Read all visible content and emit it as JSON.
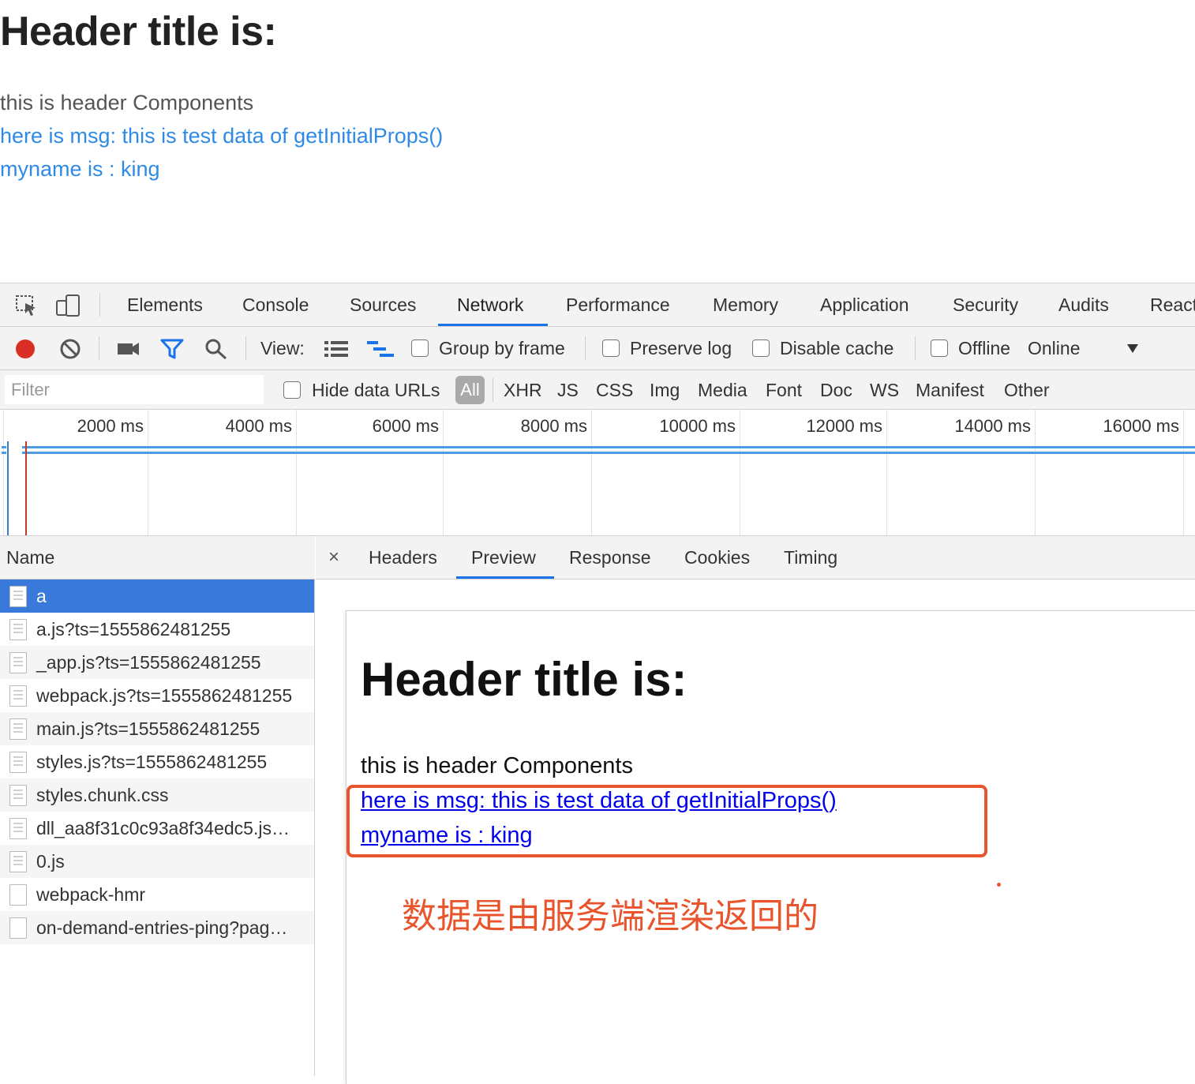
{
  "page": {
    "title": "Header title is:",
    "line1": "this is header Components",
    "line2": "here is msg: this is test data of getInitialProps()",
    "line3": "myname is : king"
  },
  "devtools": {
    "tabs": [
      "Elements",
      "Console",
      "Sources",
      "Network",
      "Performance",
      "Memory",
      "Application",
      "Security",
      "Audits",
      "React"
    ],
    "active_tab": "Network",
    "toolbar": {
      "view_label": "View:",
      "group_by_frame": "Group by frame",
      "preserve_log": "Preserve log",
      "disable_cache": "Disable cache",
      "offline": "Offline",
      "throttling": "Online"
    },
    "filter": {
      "placeholder": "Filter",
      "hide_data_urls": "Hide data URLs",
      "types": [
        "All",
        "XHR",
        "JS",
        "CSS",
        "Img",
        "Media",
        "Font",
        "Doc",
        "WS",
        "Manifest",
        "Other"
      ],
      "active_type": "All"
    },
    "timeline": {
      "ticks": [
        "2000 ms",
        "4000 ms",
        "6000 ms",
        "8000 ms",
        "10000 ms",
        "12000 ms",
        "14000 ms",
        "16000 ms"
      ]
    },
    "requests": {
      "header": "Name",
      "rows": [
        "a",
        "a.js?ts=1555862481255",
        "_app.js?ts=1555862481255",
        "webpack.js?ts=1555862481255",
        "main.js?ts=1555862481255",
        "styles.js?ts=1555862481255",
        "styles.chunk.css",
        "dll_aa8f31c0c93a8f34edc5.js…",
        "0.js",
        "webpack-hmr",
        "on-demand-entries-ping?pag…"
      ],
      "selected": "a"
    },
    "detail": {
      "close": "×",
      "tabs": [
        "Headers",
        "Preview",
        "Response",
        "Cookies",
        "Timing"
      ],
      "active_tab": "Preview",
      "preview": {
        "title": "Header title is:",
        "line1": "this is header Components",
        "line2": "here is msg: this is test data of getInitialProps()",
        "line3": "myname is : king"
      },
      "annotation": "数据是由服务端渲染返回的"
    }
  },
  "colors": {
    "accent": "#1a73e8",
    "page_link": "#2f8ae5",
    "selected_row": "#3879d9",
    "annotation": "#e8552d",
    "record": "#d93025"
  }
}
